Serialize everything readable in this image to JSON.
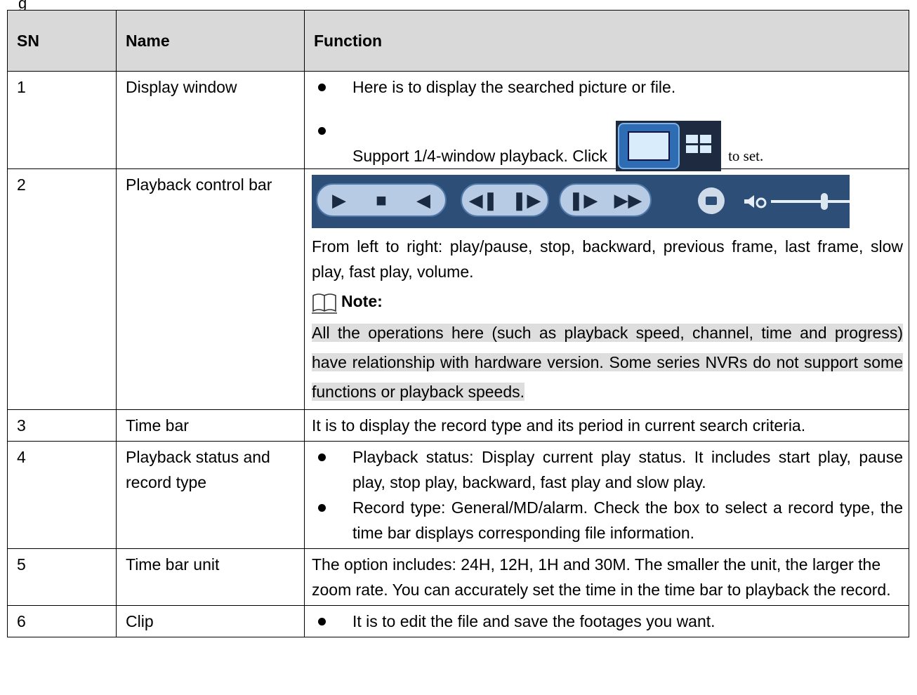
{
  "top_fragment": "g",
  "table": {
    "headers": {
      "sn": "SN",
      "name": "Name",
      "function": "Function"
    },
    "rows": [
      {
        "sn": "1",
        "name": "Display window",
        "bullets": [
          "Here is to display the searched picture or file.",
          "Support 1/4-window playback. Click"
        ],
        "suffix": "to set."
      },
      {
        "sn": "2",
        "name": "Playback control bar",
        "text": "From left to right: play/pause, stop, backward, previous frame, last frame, slow play, fast play, volume.",
        "note_title": "Note:",
        "note_text": "All the operations here (such as playback speed, channel, time and progress) have relationship with hardware version. Some series NVRs do not support some functions or playback speeds."
      },
      {
        "sn": "3",
        "name": "Time bar",
        "text": "It is to display the record type and its period in current search criteria."
      },
      {
        "sn": "4",
        "name": "Playback status and record type",
        "bullets": [
          "Playback status: Display current play status. It includes start play, pause play, stop play, backward, fast play and slow play.",
          "Record type: General/MD/alarm. Check the box to select a record type, the time bar displays corresponding file information."
        ]
      },
      {
        "sn": "5",
        "name": "Time bar unit",
        "text": "The option includes: 24H, 12H, 1H and 30M. The smaller the unit, the larger the zoom rate. You can accurately set the time in the time bar to playback the record."
      },
      {
        "sn": "6",
        "name": "Clip",
        "bullets": [
          "It is to edit the file and save the footages you want."
        ]
      }
    ]
  },
  "icons": {
    "window_buttons": "single-and-quad-window-icon",
    "control_bar": [
      "play-icon",
      "stop-icon",
      "backward-icon",
      "previous-frame-icon",
      "next-frame-icon",
      "slow-play-icon",
      "fast-play-icon",
      "snapshot-icon",
      "volume-icon"
    ],
    "note": "book-icon"
  },
  "colors": {
    "header_bg": "#d9d9d9",
    "note_highlight": "#dedede",
    "control_bar_bg": "#2d4e76"
  },
  "volume_level": 0.7
}
